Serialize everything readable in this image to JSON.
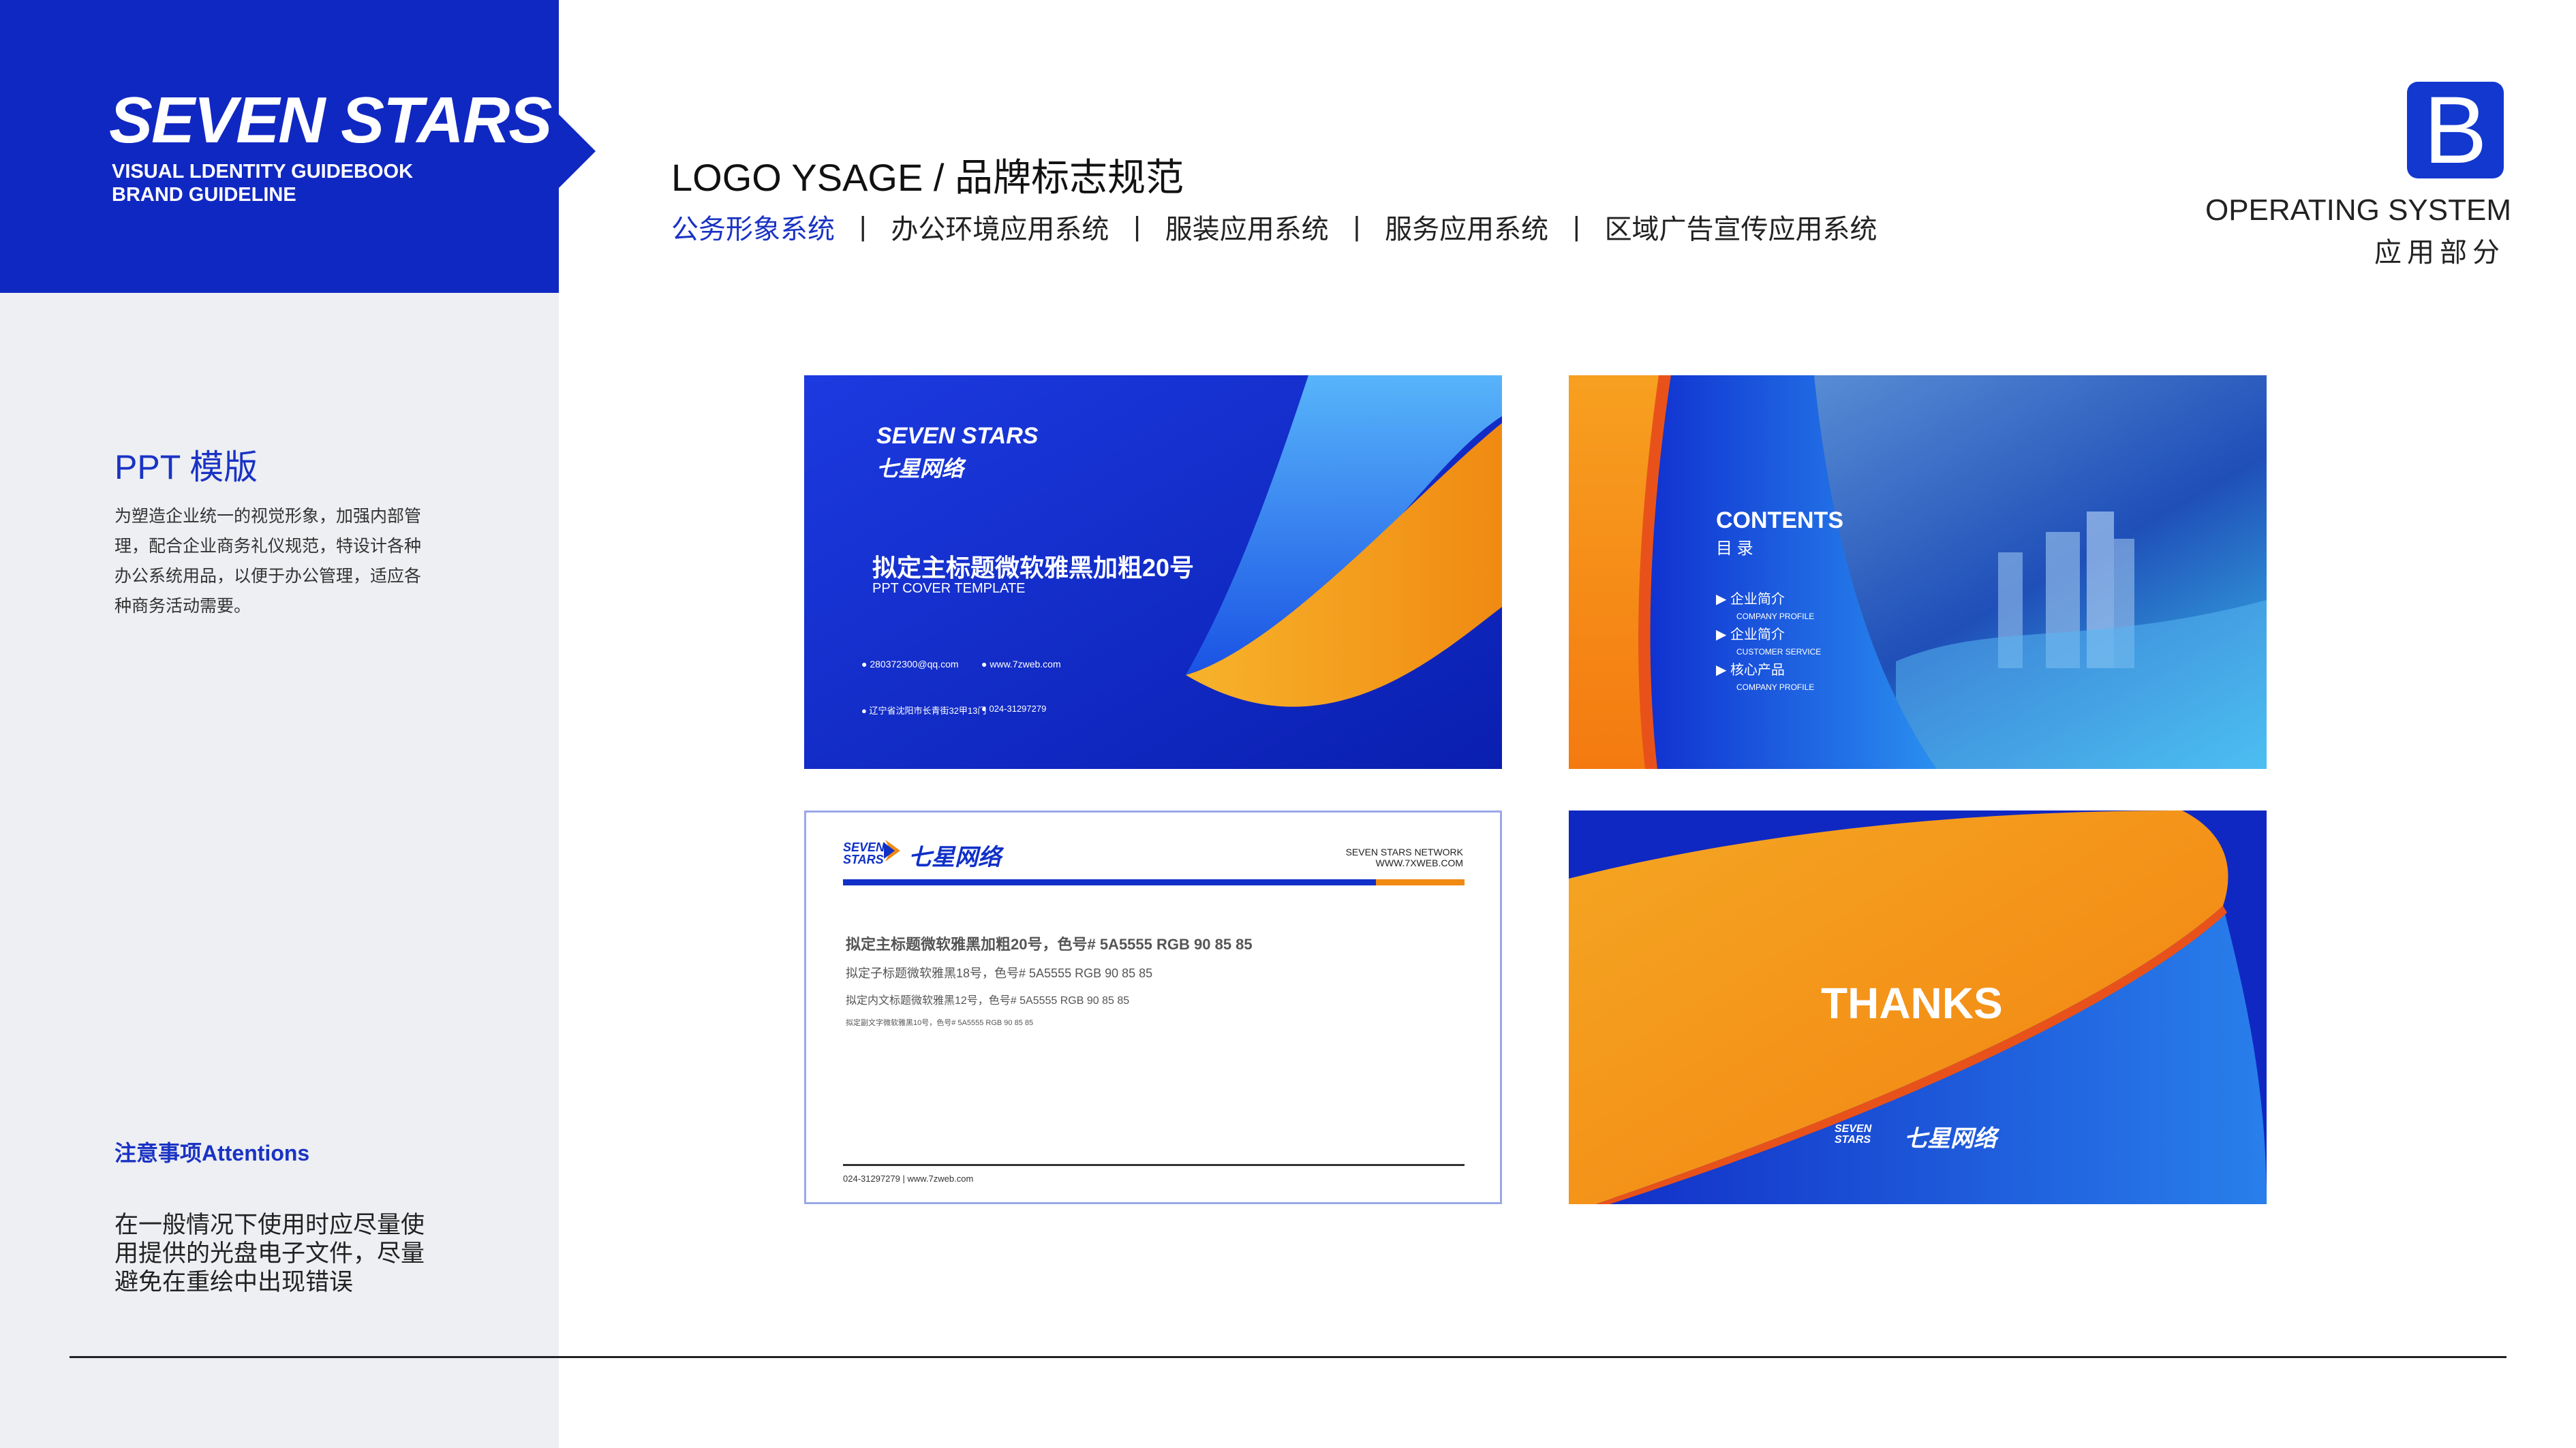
{
  "brand": {
    "logo": "SEVEN STARS",
    "subtitle_1": "VISUAL LDENTITY GUIDEBOOK",
    "subtitle_2": "BRAND GUIDELINE"
  },
  "header": {
    "title": "LOGO YSAGE / 品牌标志规范",
    "nav": [
      "公务形象系统",
      "办公环境应用系统",
      "服装应用系统",
      "服务应用系统",
      "区域广告宣传应用系统"
    ],
    "nav_separator": "|",
    "badge_letter": "B",
    "operating_title": "OPERATING SYSTEM",
    "operating_sub": "应用部分"
  },
  "sidebar": {
    "section_title": "PPT 模版",
    "section_desc": "为塑造企业统一的视觉形象，加强内部管理，配合企业商务礼仪规范，特设计各种办公系统用品，以便于办公管理，适应各种商务活动需要。",
    "attention_title": "注意事项Attentions",
    "attention_desc": "在一般情况下使用时应尽量使用提供的光盘电子文件，尽量避免在重绘中出现错误"
  },
  "cards": {
    "cover": {
      "logo_en": "SEVEN STARS",
      "logo_cn": "七星网络",
      "title": "拟定主标题微软雅黑加粗20号",
      "subtitle": "PPT COVER TEMPLATE",
      "email": "280372300@qq.com",
      "website": "www.7zweb.com",
      "address": "辽宁省沈阳市长青街32甲13门",
      "phone": "024-31297279"
    },
    "contents": {
      "heading": "CONTENTS",
      "heading_cn": "目 录",
      "items": [
        {
          "title": "企业简介",
          "sub": "COMPANY PROFILE"
        },
        {
          "title": "企业简介",
          "sub": "CUSTOMER SERVICE"
        },
        {
          "title": "核心产品",
          "sub": "COMPANY PROFILE"
        }
      ]
    },
    "content_page": {
      "logo_en": "SEVEN STARS",
      "logo_cn": "七星网络",
      "network": "SEVEN STARS NETWORK",
      "web": "WWW.7XWEB.COM",
      "line1": "拟定主标题微软雅黑加粗20号，色号# 5A5555  RGB 90 85 85",
      "line2": "拟定子标题微软雅黑18号，色号# 5A5555  RGB 90 85 85",
      "line3": "拟定内文标题微软雅黑12号，色号# 5A5555  RGB 90 85 85",
      "line4": "拟定副文字微软雅黑10号，色号# 5A5555  RGB 90 85 85",
      "footer": "024-31297279  |  www.7zweb.com"
    },
    "thanks": {
      "text": "THANKS",
      "logo_en": "SEVEN STARS",
      "logo_cn": "七星网络"
    }
  },
  "colors": {
    "brand_blue": "#1028c2",
    "accent_orange": "#f5a21e",
    "panel_gray": "#edeff2"
  }
}
